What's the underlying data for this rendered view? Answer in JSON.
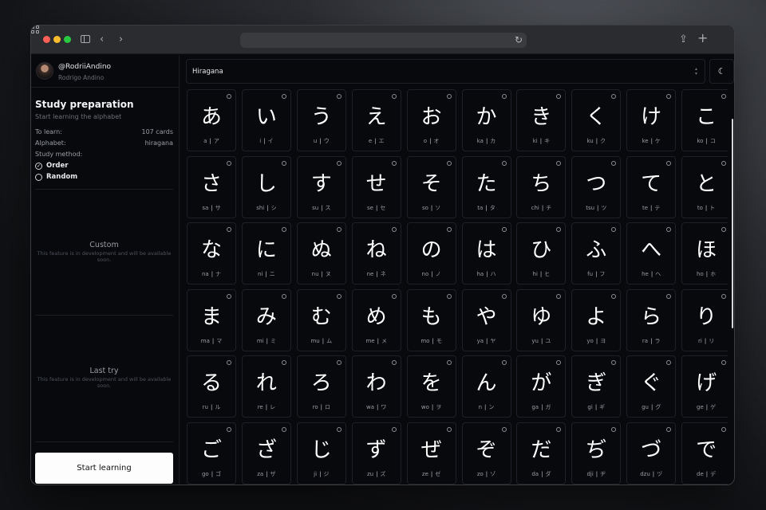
{
  "browser": {
    "address": ""
  },
  "profile": {
    "handle": "@RodriiAndino",
    "name": "Rodrigo Andino"
  },
  "sidebar": {
    "title": "Study preparation",
    "subtitle": "Start learning the alphabet",
    "to_learn_label": "To learn:",
    "to_learn_value": "107 cards",
    "alphabet_label": "Alphabet:",
    "alphabet_value": "hiragana",
    "method_label": "Study method:",
    "methods": [
      {
        "label": "Order",
        "selected": true
      },
      {
        "label": "Random",
        "selected": false
      }
    ],
    "custom": {
      "title": "Custom",
      "description": "This feature is in development and will be available soon."
    },
    "last_try": {
      "title": "Last try",
      "description": "This feature is in development and will be available soon."
    },
    "start_button": "Start learning"
  },
  "alphabet_select": {
    "value": "Hiragana"
  },
  "cards": [
    {
      "kana": "あ",
      "romaji": "a",
      "katakana": "ア"
    },
    {
      "kana": "い",
      "romaji": "i",
      "katakana": "イ"
    },
    {
      "kana": "う",
      "romaji": "u",
      "katakana": "ウ"
    },
    {
      "kana": "え",
      "romaji": "e",
      "katakana": "エ"
    },
    {
      "kana": "お",
      "romaji": "o",
      "katakana": "オ"
    },
    {
      "kana": "か",
      "romaji": "ka",
      "katakana": "カ"
    },
    {
      "kana": "き",
      "romaji": "ki",
      "katakana": "キ"
    },
    {
      "kana": "く",
      "romaji": "ku",
      "katakana": "ク"
    },
    {
      "kana": "け",
      "romaji": "ke",
      "katakana": "ケ"
    },
    {
      "kana": "こ",
      "romaji": "ko",
      "katakana": "コ"
    },
    {
      "kana": "さ",
      "romaji": "sa",
      "katakana": "サ"
    },
    {
      "kana": "し",
      "romaji": "shi",
      "katakana": "シ"
    },
    {
      "kana": "す",
      "romaji": "su",
      "katakana": "ス"
    },
    {
      "kana": "せ",
      "romaji": "se",
      "katakana": "セ"
    },
    {
      "kana": "そ",
      "romaji": "so",
      "katakana": "ソ"
    },
    {
      "kana": "た",
      "romaji": "ta",
      "katakana": "タ"
    },
    {
      "kana": "ち",
      "romaji": "chi",
      "katakana": "チ"
    },
    {
      "kana": "つ",
      "romaji": "tsu",
      "katakana": "ツ"
    },
    {
      "kana": "て",
      "romaji": "te",
      "katakana": "テ"
    },
    {
      "kana": "と",
      "romaji": "to",
      "katakana": "ト"
    },
    {
      "kana": "な",
      "romaji": "na",
      "katakana": "ナ"
    },
    {
      "kana": "に",
      "romaji": "ni",
      "katakana": "ニ"
    },
    {
      "kana": "ぬ",
      "romaji": "nu",
      "katakana": "ヌ"
    },
    {
      "kana": "ね",
      "romaji": "ne",
      "katakana": "ネ"
    },
    {
      "kana": "の",
      "romaji": "no",
      "katakana": "ノ"
    },
    {
      "kana": "は",
      "romaji": "ha",
      "katakana": "ハ"
    },
    {
      "kana": "ひ",
      "romaji": "hi",
      "katakana": "ヒ"
    },
    {
      "kana": "ふ",
      "romaji": "fu",
      "katakana": "フ"
    },
    {
      "kana": "へ",
      "romaji": "he",
      "katakana": "ヘ"
    },
    {
      "kana": "ほ",
      "romaji": "ho",
      "katakana": "ホ"
    },
    {
      "kana": "ま",
      "romaji": "ma",
      "katakana": "マ"
    },
    {
      "kana": "み",
      "romaji": "mi",
      "katakana": "ミ"
    },
    {
      "kana": "む",
      "romaji": "mu",
      "katakana": "ム"
    },
    {
      "kana": "め",
      "romaji": "me",
      "katakana": "メ"
    },
    {
      "kana": "も",
      "romaji": "mo",
      "katakana": "モ"
    },
    {
      "kana": "や",
      "romaji": "ya",
      "katakana": "ヤ"
    },
    {
      "kana": "ゆ",
      "romaji": "yu",
      "katakana": "ユ"
    },
    {
      "kana": "よ",
      "romaji": "yo",
      "katakana": "ヨ"
    },
    {
      "kana": "ら",
      "romaji": "ra",
      "katakana": "ラ"
    },
    {
      "kana": "り",
      "romaji": "ri",
      "katakana": "リ"
    },
    {
      "kana": "る",
      "romaji": "ru",
      "katakana": "ル"
    },
    {
      "kana": "れ",
      "romaji": "re",
      "katakana": "レ"
    },
    {
      "kana": "ろ",
      "romaji": "ro",
      "katakana": "ロ"
    },
    {
      "kana": "わ",
      "romaji": "wa",
      "katakana": "ワ"
    },
    {
      "kana": "を",
      "romaji": "wo",
      "katakana": "ヲ"
    },
    {
      "kana": "ん",
      "romaji": "n",
      "katakana": "ン"
    },
    {
      "kana": "が",
      "romaji": "ga",
      "katakana": "ガ"
    },
    {
      "kana": "ぎ",
      "romaji": "gi",
      "katakana": "ギ"
    },
    {
      "kana": "ぐ",
      "romaji": "gu",
      "katakana": "グ"
    },
    {
      "kana": "げ",
      "romaji": "ge",
      "katakana": "ゲ"
    },
    {
      "kana": "ご",
      "romaji": "go",
      "katakana": "ゴ"
    },
    {
      "kana": "ざ",
      "romaji": "za",
      "katakana": "ザ"
    },
    {
      "kana": "じ",
      "romaji": "ji",
      "katakana": "ジ"
    },
    {
      "kana": "ず",
      "romaji": "zu",
      "katakana": "ズ"
    },
    {
      "kana": "ぜ",
      "romaji": "ze",
      "katakana": "ゼ"
    },
    {
      "kana": "ぞ",
      "romaji": "zo",
      "katakana": "ゾ"
    },
    {
      "kana": "だ",
      "romaji": "da",
      "katakana": "ダ"
    },
    {
      "kana": "ぢ",
      "romaji": "dji",
      "katakana": "ヂ"
    },
    {
      "kana": "づ",
      "romaji": "dzu",
      "katakana": "ヅ"
    },
    {
      "kana": "で",
      "romaji": "de",
      "katakana": "デ"
    }
  ],
  "icons": {
    "reload": "reload-icon",
    "share": "share-icon",
    "new_tab": "plus-icon",
    "tab_overview": "tab-grid-icon",
    "theme": "moon-icon",
    "select_caret": "updown-chevron-icon"
  },
  "colors": {
    "background": "#07090d",
    "border": "#1d2026",
    "text": "#ffffff",
    "muted": "#9a9da3",
    "button": "#fdfdfd"
  }
}
